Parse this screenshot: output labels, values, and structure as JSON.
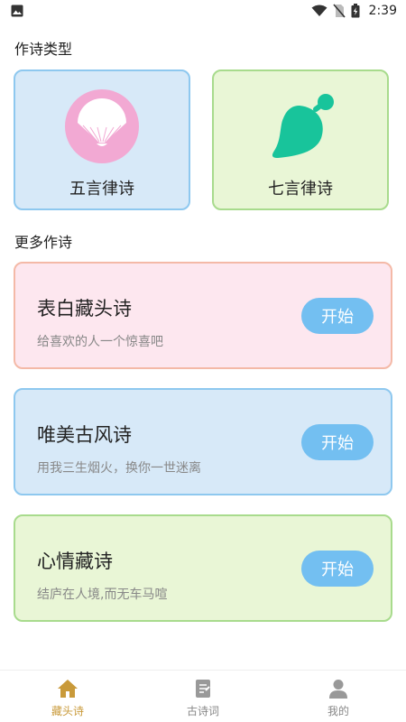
{
  "status_bar": {
    "time": "2:39",
    "icons": [
      "image-notification-icon",
      "wifi-icon",
      "no-sim-icon",
      "battery-charging-icon"
    ]
  },
  "sections": {
    "poem_types_title": "作诗类型",
    "more_title": "更多作诗"
  },
  "poem_types": [
    {
      "label": "五言律诗",
      "icon": "folding-fan-icon"
    },
    {
      "label": "七言律诗",
      "icon": "leaf-icon"
    }
  ],
  "more_items": [
    {
      "title": "表白藏头诗",
      "subtitle": "给喜欢的人一个惊喜吧",
      "button": "开始"
    },
    {
      "title": "唯美古风诗",
      "subtitle": "用我三生烟火，换你一世迷离",
      "button": "开始"
    },
    {
      "title": "心情藏诗",
      "subtitle": "结庐在人境,而无车马喧",
      "button": "开始"
    }
  ],
  "tabs": [
    {
      "label": "藏头诗",
      "icon": "home-icon",
      "active": true
    },
    {
      "label": "古诗词",
      "icon": "document-icon",
      "active": false
    },
    {
      "label": "我的",
      "icon": "user-icon",
      "active": false
    }
  ],
  "colors": {
    "accent": "#73bff1",
    "active_tab": "#c99a3a",
    "fan": "#f2a9d3",
    "leaf": "#18c49b"
  }
}
